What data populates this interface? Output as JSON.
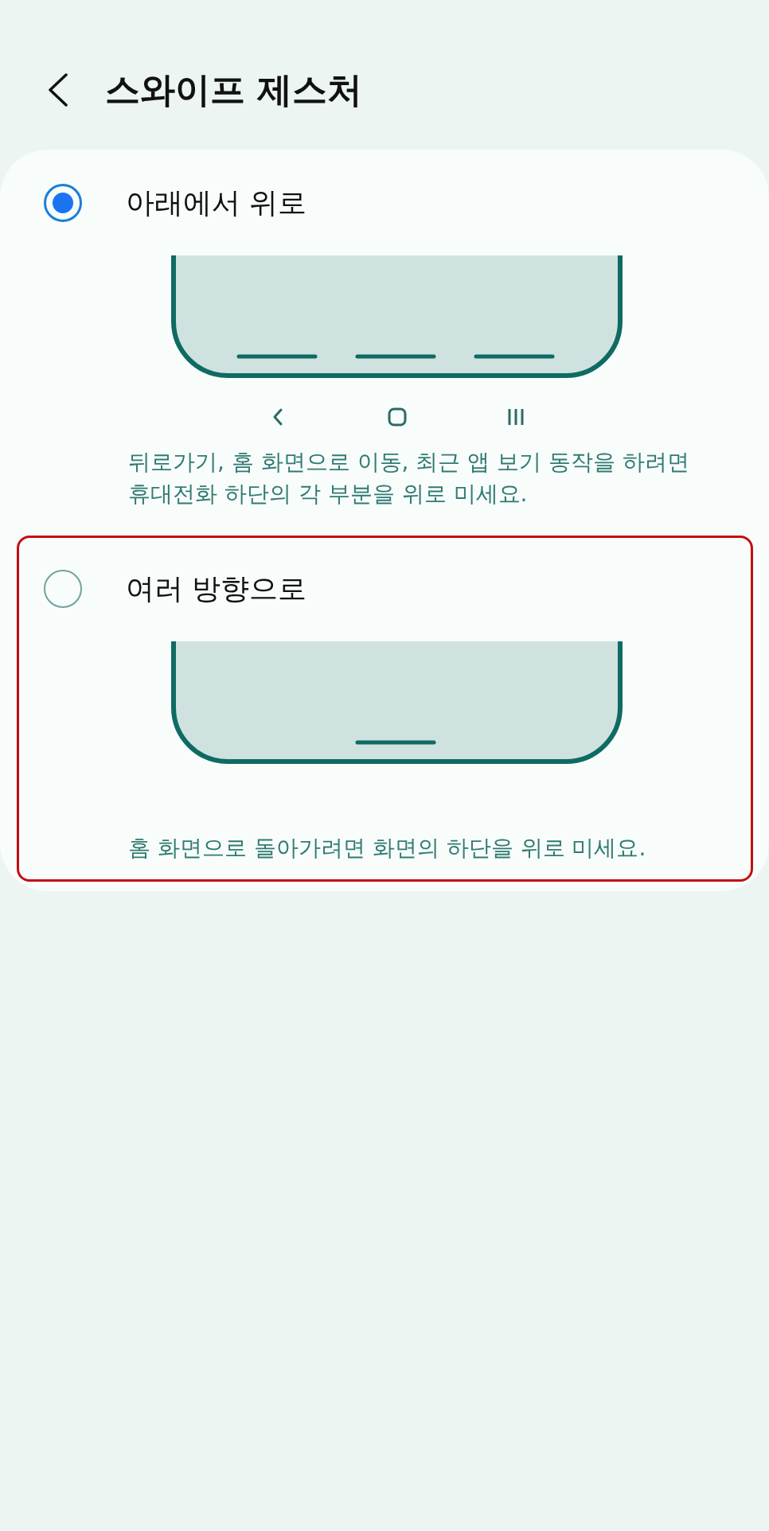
{
  "header": {
    "title": "스와이프 제스처"
  },
  "options": [
    {
      "label": "아래에서 위로",
      "selected": true,
      "highlighted": false,
      "kind": "three_bars",
      "description": "뒤로가기, 홈 화면으로 이동, 최근 앱 보기 동작을 하려면 휴대전화 하단의 각 부분을 위로 미세요."
    },
    {
      "label": "여러 방향으로",
      "selected": false,
      "highlighted": true,
      "kind": "single_bar",
      "description": "홈 화면으로 돌아가려면 화면의 하단을 위로 미세요."
    }
  ]
}
